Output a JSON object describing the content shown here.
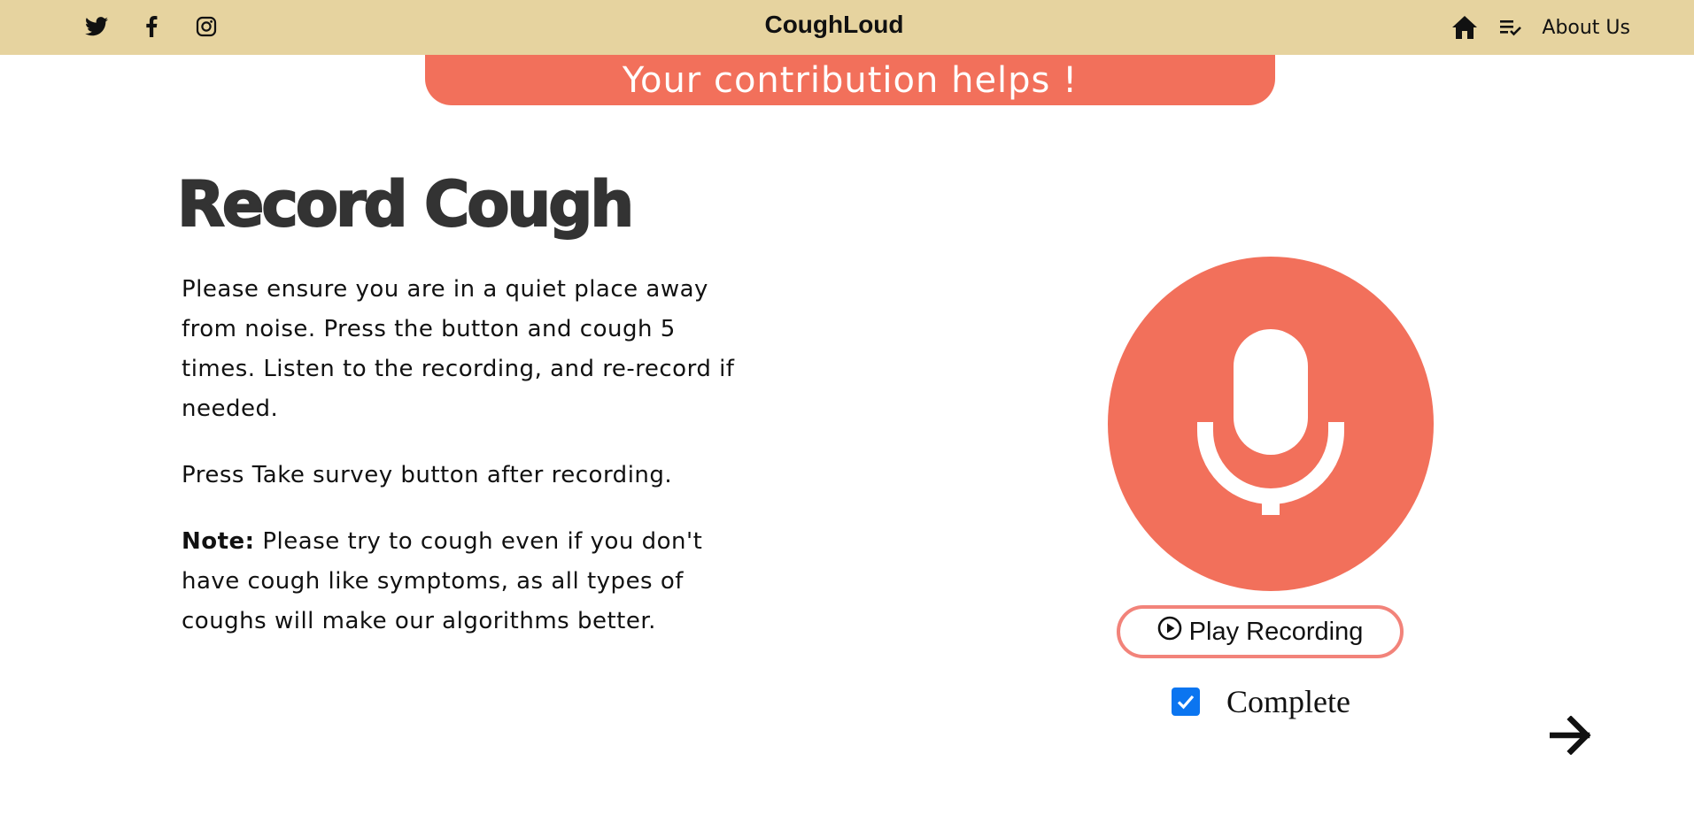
{
  "navbar": {
    "brand": "CoughLoud",
    "social": [
      {
        "icon": "twitter-icon"
      },
      {
        "icon": "facebook-icon"
      },
      {
        "icon": "instagram-icon"
      }
    ],
    "home_icon": "home-icon",
    "list_icon": "checklist-icon",
    "about_label": "About Us",
    "background": "#e6d39f"
  },
  "banner": {
    "text": "Your contribution helps !",
    "color": "#f2705b"
  },
  "main": {
    "title": "Record Cough",
    "paragraph1": "Please ensure you are in a quiet place away from noise. Press the button and cough 5 times. Listen to the recording, and re-record if needed.",
    "paragraph2": "Press Take survey button after recording.",
    "note_label": "Note:",
    "note_text": " Please try to cough even if you don't have cough like symptoms, as all types of coughs will make our algorithms better."
  },
  "recorder": {
    "mic_icon": "microphone-icon",
    "play_label": "Play Recording",
    "play_icon": "play-circle-icon",
    "complete_label": "Complete",
    "complete_checked": true,
    "next_icon": "arrow-right-icon",
    "accent": "#f2705b",
    "checkbox_color": "#0b75f0"
  }
}
